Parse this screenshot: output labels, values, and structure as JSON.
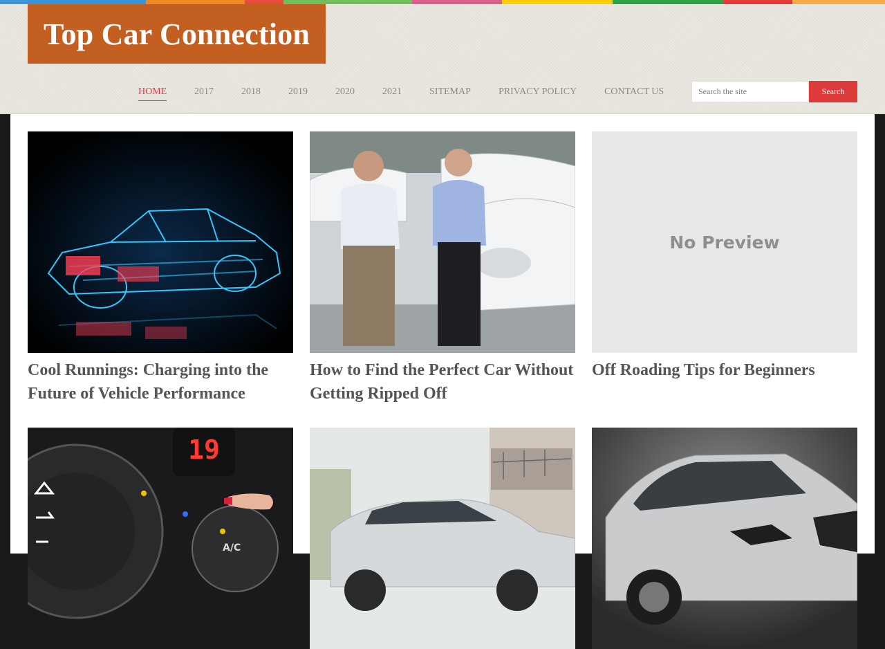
{
  "site": {
    "title": "Top Car Connection"
  },
  "topbar_colors": [
    "#3a95d9",
    "#f08a24",
    "#e84c3d",
    "#71bf5c",
    "#dd5f8d",
    "#ffcc00",
    "#2ea34a",
    "#e63b3b",
    "#f8a847"
  ],
  "nav": {
    "items": [
      {
        "label": "HOME",
        "active": true
      },
      {
        "label": "2017"
      },
      {
        "label": "2018"
      },
      {
        "label": "2019"
      },
      {
        "label": "2020"
      },
      {
        "label": "2021"
      },
      {
        "label": "SITEMAP"
      },
      {
        "label": "PRIVACY POLICY"
      },
      {
        "label": "CONTACT US"
      }
    ]
  },
  "search": {
    "placeholder": "Search the site",
    "button_label": "Search"
  },
  "posts": [
    {
      "title": "Cool Runnings: Charging into the Future of Vehicle Performance",
      "image": "car-xray"
    },
    {
      "title": "How to Find the Perfect Car Without Getting Ripped Off",
      "image": "dealership"
    },
    {
      "title": "Off Roading Tips for Beginners",
      "image": "no-preview",
      "image_text": "No Preview"
    },
    {
      "title": "",
      "image": "climate-control"
    },
    {
      "title": "",
      "image": "silver-wagon"
    },
    {
      "title": "",
      "image": "silver-suv"
    }
  ]
}
